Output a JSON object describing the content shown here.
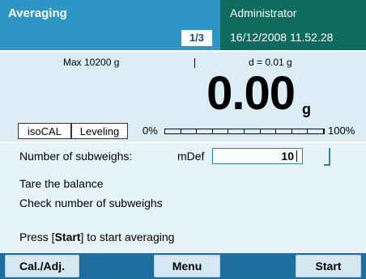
{
  "header": {
    "title": "Averaging",
    "page_indicator": "1/3",
    "user": "Administrator",
    "datetime": "16/12/2008 11.52.28"
  },
  "weight": {
    "max_label": "Max 10200 g",
    "d_label": "d = 0.01 g",
    "value": "0.00",
    "unit": "g",
    "tabs": [
      "isoCAL",
      "Leveling"
    ],
    "bar_min_label": "0%",
    "bar_max_label": "100%",
    "bar_fill_fraction": 0
  },
  "main": {
    "subweighs_label": "Number of subweighs:",
    "subweighs_mode": "mDef",
    "subweighs_value": "10",
    "instruction_1": "Tare the balance",
    "instruction_2": "Check number of subweighs",
    "press_prefix": "Press [",
    "press_key": "Start",
    "press_suffix": "] to start averaging"
  },
  "footer": {
    "cal_label": "Cal./Adj.",
    "menu_label": "Menu",
    "start_label": "Start"
  },
  "colors": {
    "header_bg": "#2d96c5",
    "user_panel_bg": "#0f6b5e",
    "footer_bg": "#1e6fa0",
    "button_bg": "#d5e7f2"
  }
}
